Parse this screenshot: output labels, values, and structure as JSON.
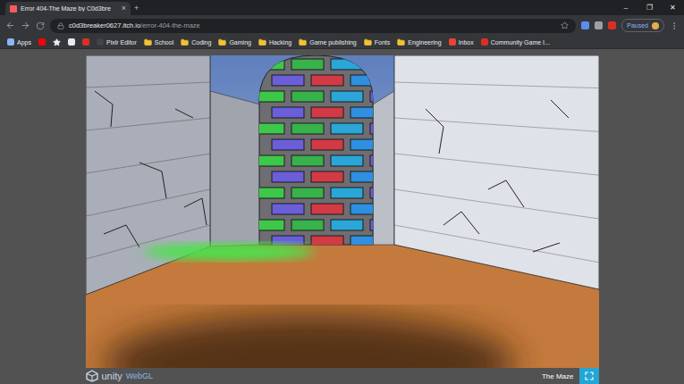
{
  "window": {
    "tab_title": "Error 404-The Maze by C0d3bre",
    "tab_close": "×",
    "new_tab": "+",
    "controls": [
      "–",
      "❐",
      "✕"
    ]
  },
  "address_bar": {
    "host": "c0d3breaker0627.itch.io",
    "path": "/error-404-the-maze"
  },
  "profile": {
    "label": "Paused"
  },
  "bookmarks": [
    {
      "label": "Apps",
      "kind": "apps"
    },
    {
      "label": "",
      "kind": "youtube"
    },
    {
      "label": "",
      "kind": "star"
    },
    {
      "label": "",
      "kind": "app"
    },
    {
      "label": "",
      "kind": "red"
    },
    {
      "label": "Pixlr Editor",
      "kind": "site"
    },
    {
      "label": "School",
      "kind": "folder"
    },
    {
      "label": "Coding",
      "kind": "folder"
    },
    {
      "label": "Gaming",
      "kind": "folder"
    },
    {
      "label": "Hacking",
      "kind": "folder"
    },
    {
      "label": "Game publishing",
      "kind": "folder"
    },
    {
      "label": "Fonts",
      "kind": "folder"
    },
    {
      "label": "Engineering",
      "kind": "folder"
    },
    {
      "label": "Inbox",
      "kind": "mail"
    },
    {
      "label": "Community Game I...",
      "kind": "red"
    }
  ],
  "game": {
    "engine": "unity",
    "platform": "WebGL",
    "title": "The Maze"
  }
}
